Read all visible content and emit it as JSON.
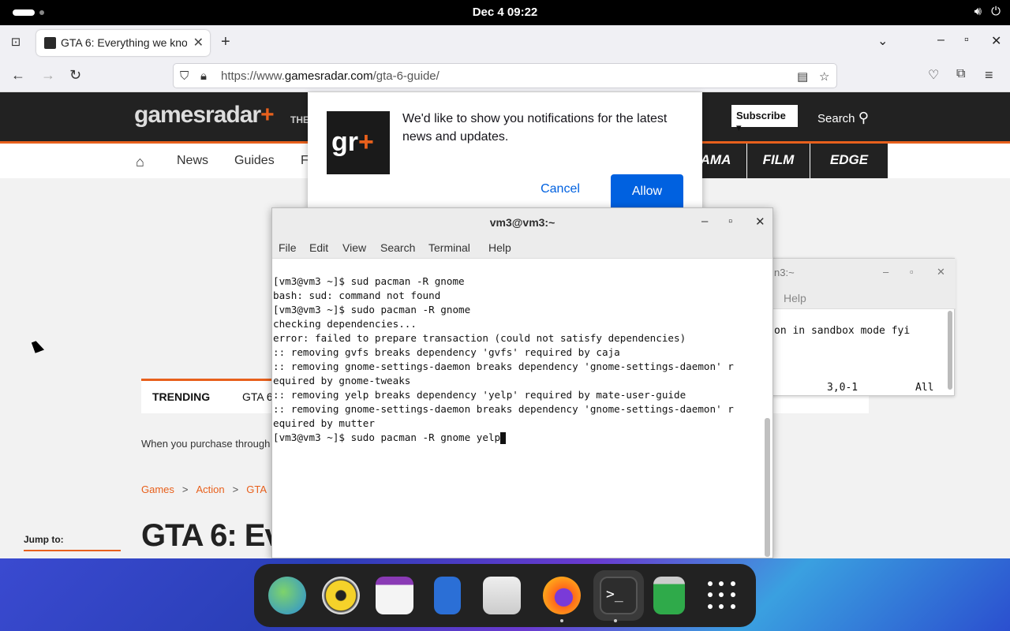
{
  "topbar": {
    "clock": "Dec 4  09:22",
    "icons": [
      "speaker-icon",
      "power-icon"
    ]
  },
  "browser": {
    "tab_title": "GTA 6: Everything we kno",
    "url_prefix": "https://www.",
    "url_domain": "gamesradar.com",
    "url_path": "/gta-6-guide/"
  },
  "site": {
    "logo_main": "gamesradar",
    "logo_plus": "+",
    "tagline_partial": "THE",
    "subscribe": "Subscribe ▾",
    "search": "Search",
    "nav": [
      "News",
      "Guides",
      "F"
    ],
    "brand_tabs": [
      "AMA",
      "FILM",
      "EDGE"
    ],
    "trending_label": "TRENDING",
    "trending_first": "GTA 6",
    "purchase_text": "When you purchase through",
    "breadcrumbs": [
      "Games",
      "Action",
      "GTA"
    ],
    "headline_partial": "GTA 6: Eve",
    "jump_to": "Jump to:"
  },
  "notification": {
    "icon_text": "gr",
    "icon_plus": "+",
    "message": "We'd like to show you notifications for the latest news and updates.",
    "cancel": "Cancel",
    "allow": "Allow"
  },
  "terminal": {
    "title": "vm3@vm3:~",
    "menu": [
      "File",
      "Edit",
      "View",
      "Search",
      "Terminal",
      "Help"
    ],
    "lines": [
      "[vm3@vm3 ~]$ sud pacman -R gnome",
      "bash: sud: command not found",
      "[vm3@vm3 ~]$ sudo pacman -R gnome",
      "checking dependencies...",
      "error: failed to prepare transaction (could not satisfy dependencies)",
      ":: removing gvfs breaks dependency 'gvfs' required by caja",
      ":: removing gnome-settings-daemon breaks dependency 'gnome-settings-daemon' r",
      "equired by gnome-tweaks",
      ":: removing yelp breaks dependency 'yelp' required by mate-user-guide",
      ":: removing gnome-settings-daemon breaks dependency 'gnome-settings-daemon' r",
      "equired by mutter"
    ],
    "current_input": "[vm3@vm3 ~]$ sudo pacman -R gnome yelp"
  },
  "terminal_back": {
    "title": "n3:~",
    "help": "Help",
    "line": "on in sandbox mode fyi",
    "position": "3,0-1",
    "scroll": "All"
  },
  "dock": {
    "apps": [
      "globe-browser-icon",
      "rhythmbox-icon",
      "calendar-icon",
      "text-editor-icon",
      "software-store-icon",
      "firefox-icon",
      "terminal-icon",
      "trash-icon",
      "app-grid-icon"
    ],
    "colors": {
      "accent": "#e8601c",
      "link": "#0061e0"
    }
  }
}
